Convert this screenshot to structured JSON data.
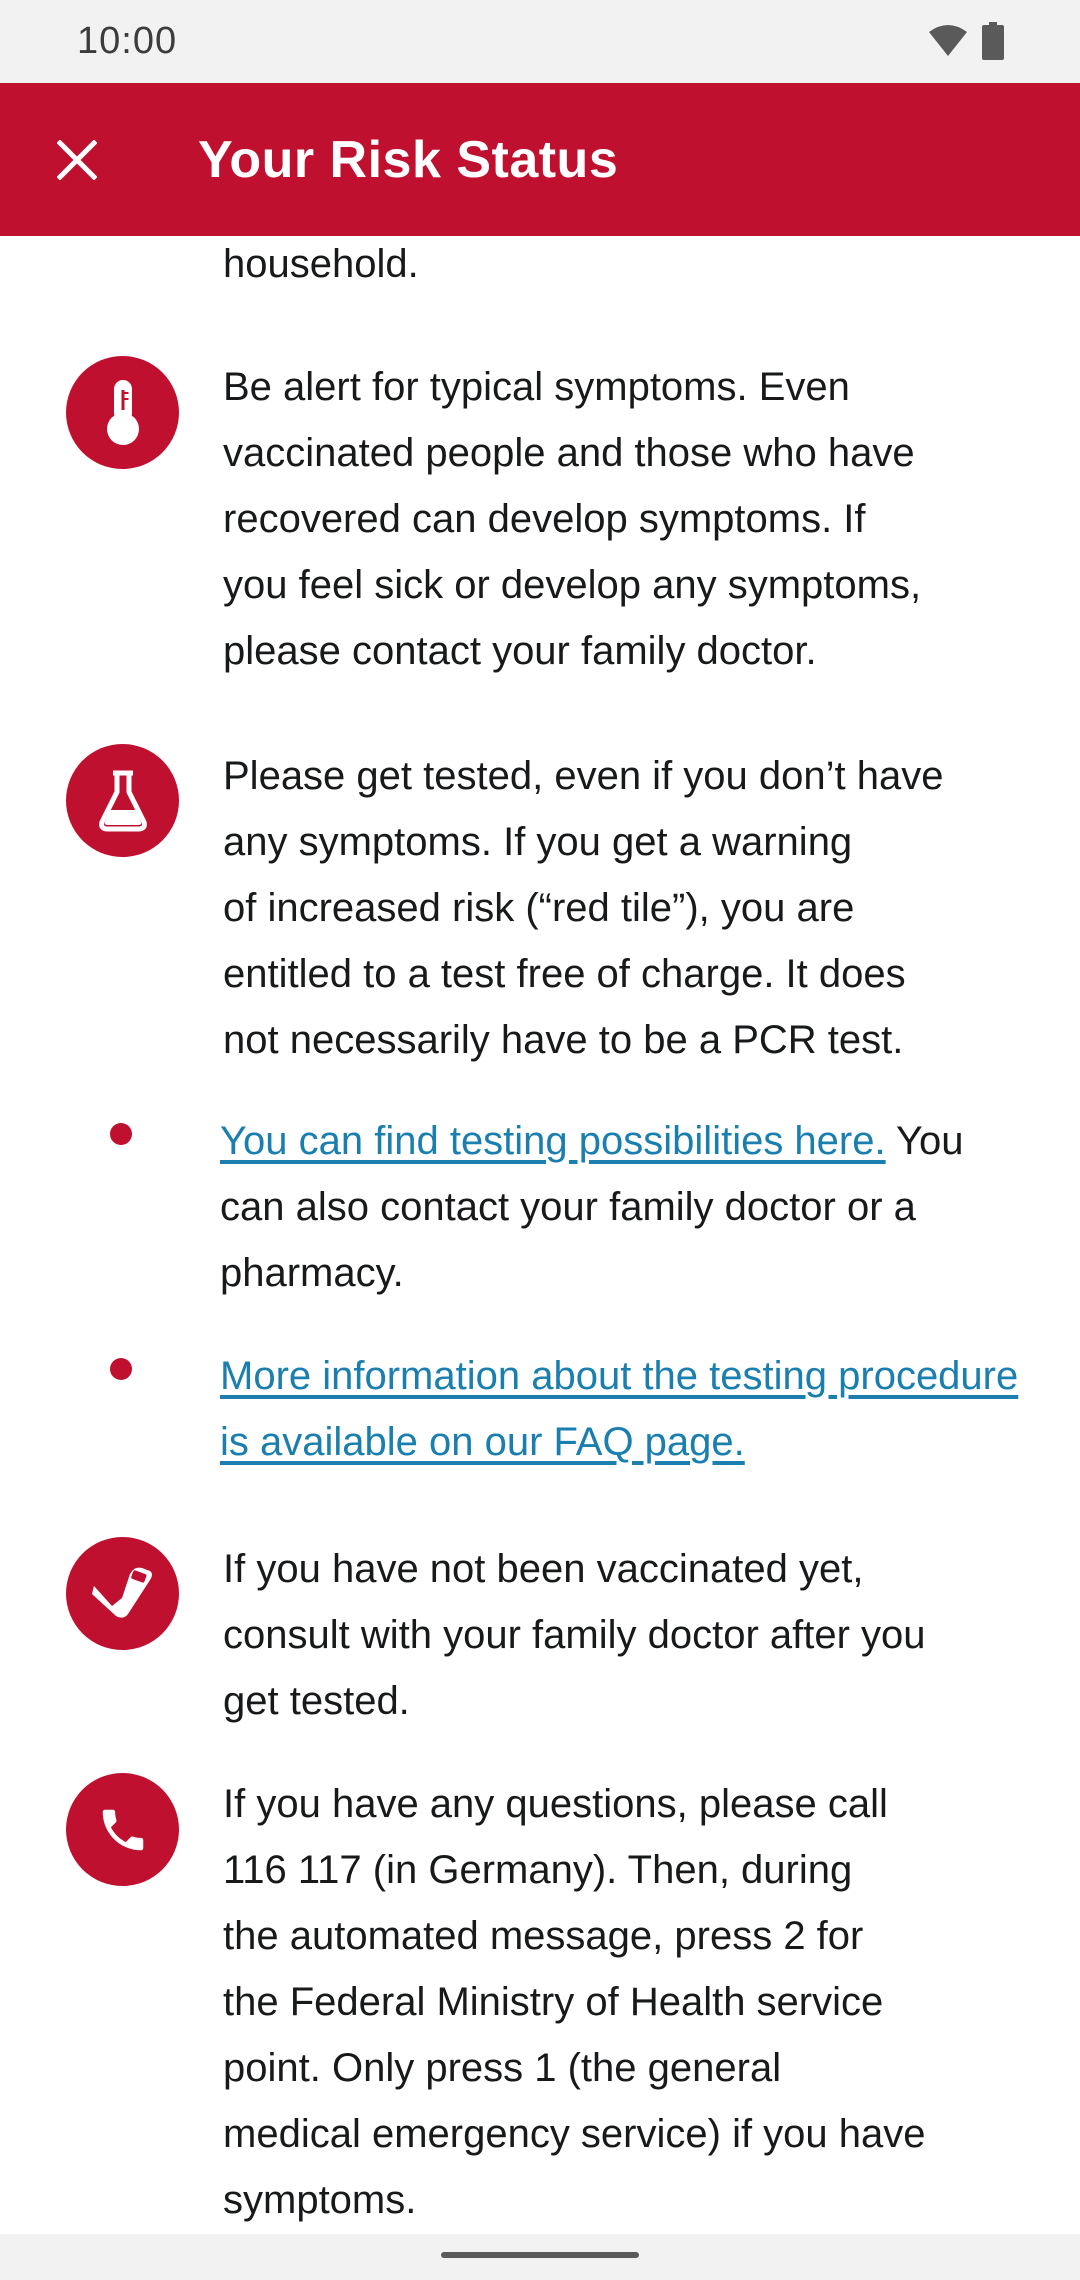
{
  "status_bar": {
    "time": "10:00",
    "icons": [
      "wifi-icon",
      "battery-icon"
    ]
  },
  "app_bar": {
    "title": "Your Risk Status",
    "close_icon": "close-icon",
    "color": "#c0102f"
  },
  "content": {
    "cut_off_text": "household.",
    "items": [
      {
        "icon": "thermometer-icon",
        "text": "Be alert for typical symptoms. Even\nvaccinated people and those who have\nrecovered can develop symptoms. If\nyou feel sick or develop any symptoms,\nplease contact your family doctor."
      },
      {
        "icon": "test-flask-icon",
        "text": "Please get tested, even if you don’t have\nany symptoms. If you get a warning\nof increased risk (“red tile”), you are\nentitled to a test free of charge. It does\nnot necessarily have to be a PCR test."
      },
      {
        "icon": "vaccination-arm-icon",
        "text": "If you have not been vaccinated yet,\nconsult with your family doctor after you\nget tested."
      },
      {
        "icon": "phone-icon",
        "text": "If you have any questions, please call\n116 117 (in Germany). Then, during\nthe automated message, press 2 for\nthe Federal Ministry of Health service\npoint. Only press 1 (the general\nmedical emergency service) if you have\nsymptoms."
      }
    ],
    "bullets": [
      {
        "link": "You can find testing possibilities here.",
        "text": "You can also contact your family doctor or a pharmacy."
      },
      {
        "link": "More information about the testing procedure is available on our FAQ page.",
        "text": ""
      }
    ],
    "link_color": "#1a7fae"
  }
}
